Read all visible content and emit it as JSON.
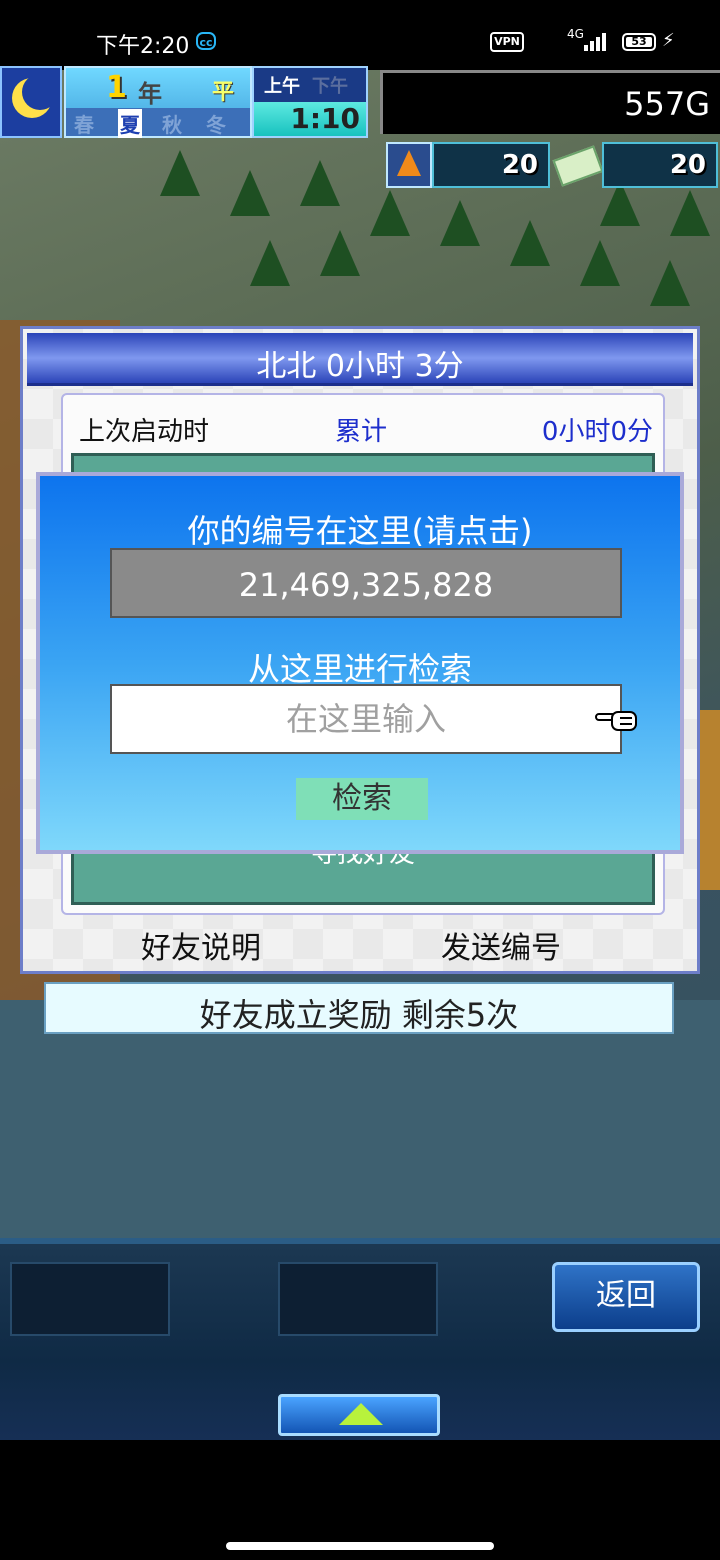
{
  "status_bar": {
    "time": "下午2:20",
    "cc_icon": "cc-app-icon",
    "vpn": "VPN",
    "network": "4G",
    "battery": "53",
    "charging_icon": "bolt-icon"
  },
  "hud": {
    "year_number": "1",
    "year_label": "年",
    "weekday": "平日",
    "seasons": [
      "春",
      "夏",
      "秋",
      "冬"
    ],
    "active_season": "夏",
    "am": "上午",
    "pm": "下午",
    "clock": "1:10",
    "money": "557G",
    "research_points": "20",
    "ticket_points": "20"
  },
  "friend_panel": {
    "title": "北北  0小时 3分",
    "last_launch_label": "上次启动时",
    "total_label": "累计",
    "total_value": "0小时0分",
    "find_friend": "寻找好友",
    "friend_help": "好友说明",
    "send_id": "发送编号"
  },
  "id_dialog": {
    "caption": "你的编号在这里(请点击)",
    "id_value": "21,469,325,828",
    "search_caption": "从这里进行检索",
    "search_placeholder": "在这里输入",
    "search_button": "检索"
  },
  "reward_bar": "好友成立奖励  剩余5次",
  "bottom_menu": {
    "back_button": "返回"
  },
  "colors": {
    "dialog_top": "#0d74ee",
    "dialog_bottom": "#7fd8fb",
    "header_blue": "#2b44b8",
    "list_green": "#5aa794",
    "search_button": "#7fdfb7"
  }
}
